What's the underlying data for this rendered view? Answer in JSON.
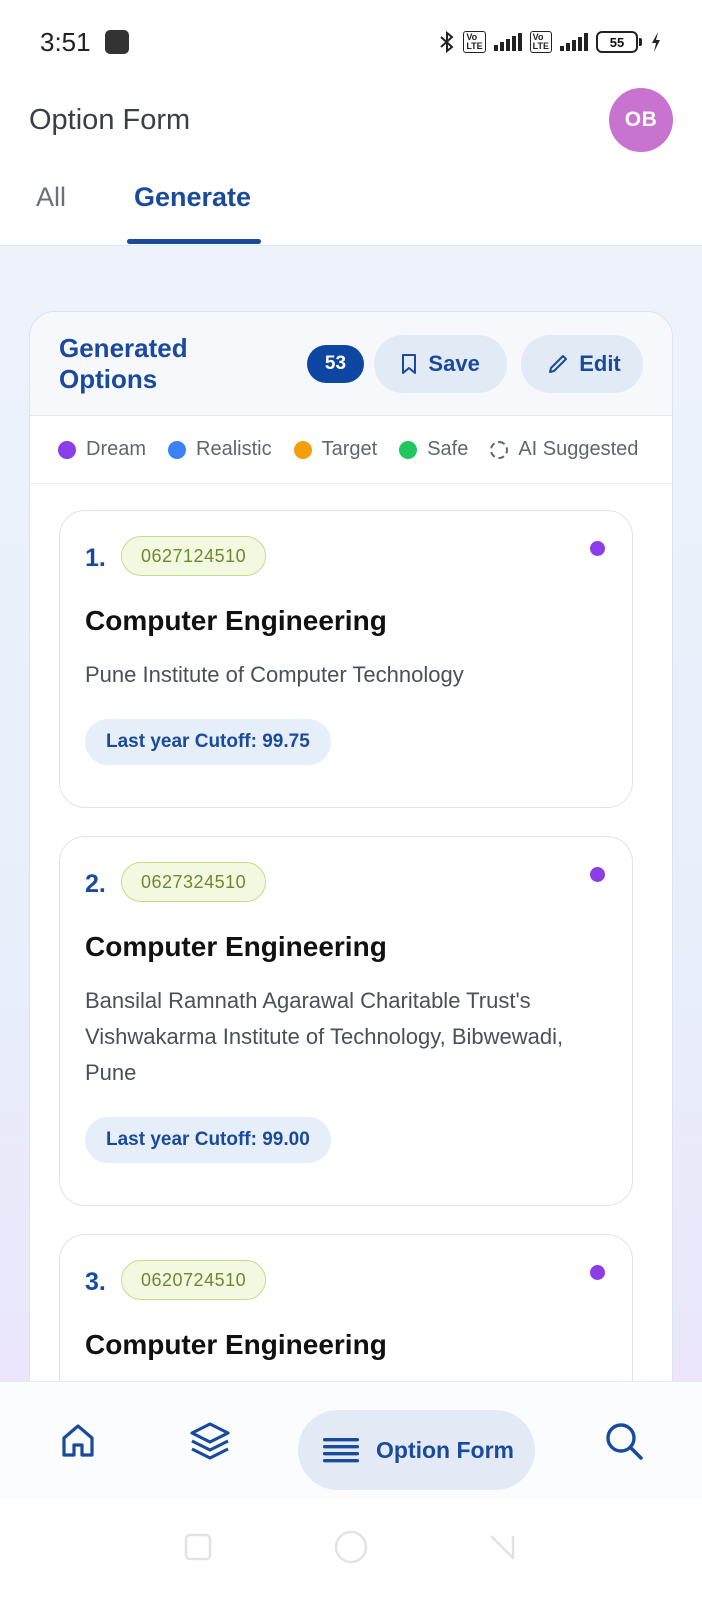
{
  "status_bar": {
    "time": "3:51",
    "battery": "55"
  },
  "header": {
    "title": "Option Form",
    "avatar_initials": "OB"
  },
  "tabs": [
    {
      "label": "All",
      "active": false
    },
    {
      "label": "Generate",
      "active": true
    }
  ],
  "panel": {
    "title": "Generated Options",
    "count": "53",
    "save_label": "Save",
    "edit_label": "Edit"
  },
  "legend": [
    {
      "label": "Dream",
      "color": "#8b3ee8"
    },
    {
      "label": "Realistic",
      "color": "#3b82f6"
    },
    {
      "label": "Target",
      "color": "#f59e0b"
    },
    {
      "label": "Safe",
      "color": "#22c55e"
    },
    {
      "label": "AI Suggested",
      "color": "dashed"
    }
  ],
  "options": [
    {
      "number": "1.",
      "code": "0627124510",
      "branch": "Computer Engineering",
      "institute": "Pune Institute of Computer Technology",
      "cutoff": "Last year Cutoff: 99.75",
      "category_color": "#8b3ee8"
    },
    {
      "number": "2.",
      "code": "0627324510",
      "branch": "Computer Engineering",
      "institute": "Bansilal Ramnath Agarawal Charitable Trust's Vishwakarma Institute of Technology, Bibwewadi, Pune",
      "cutoff": "Last year Cutoff: 99.00",
      "category_color": "#8b3ee8"
    },
    {
      "number": "3.",
      "code": "0620724510",
      "branch": "Computer Engineering",
      "category_color": "#8b3ee8"
    }
  ],
  "bottom_nav": {
    "active_label": "Option Form"
  },
  "colors": {
    "primary": "#1a4a9c",
    "badge": "#0d47a1",
    "avatar": "#c873cf"
  }
}
